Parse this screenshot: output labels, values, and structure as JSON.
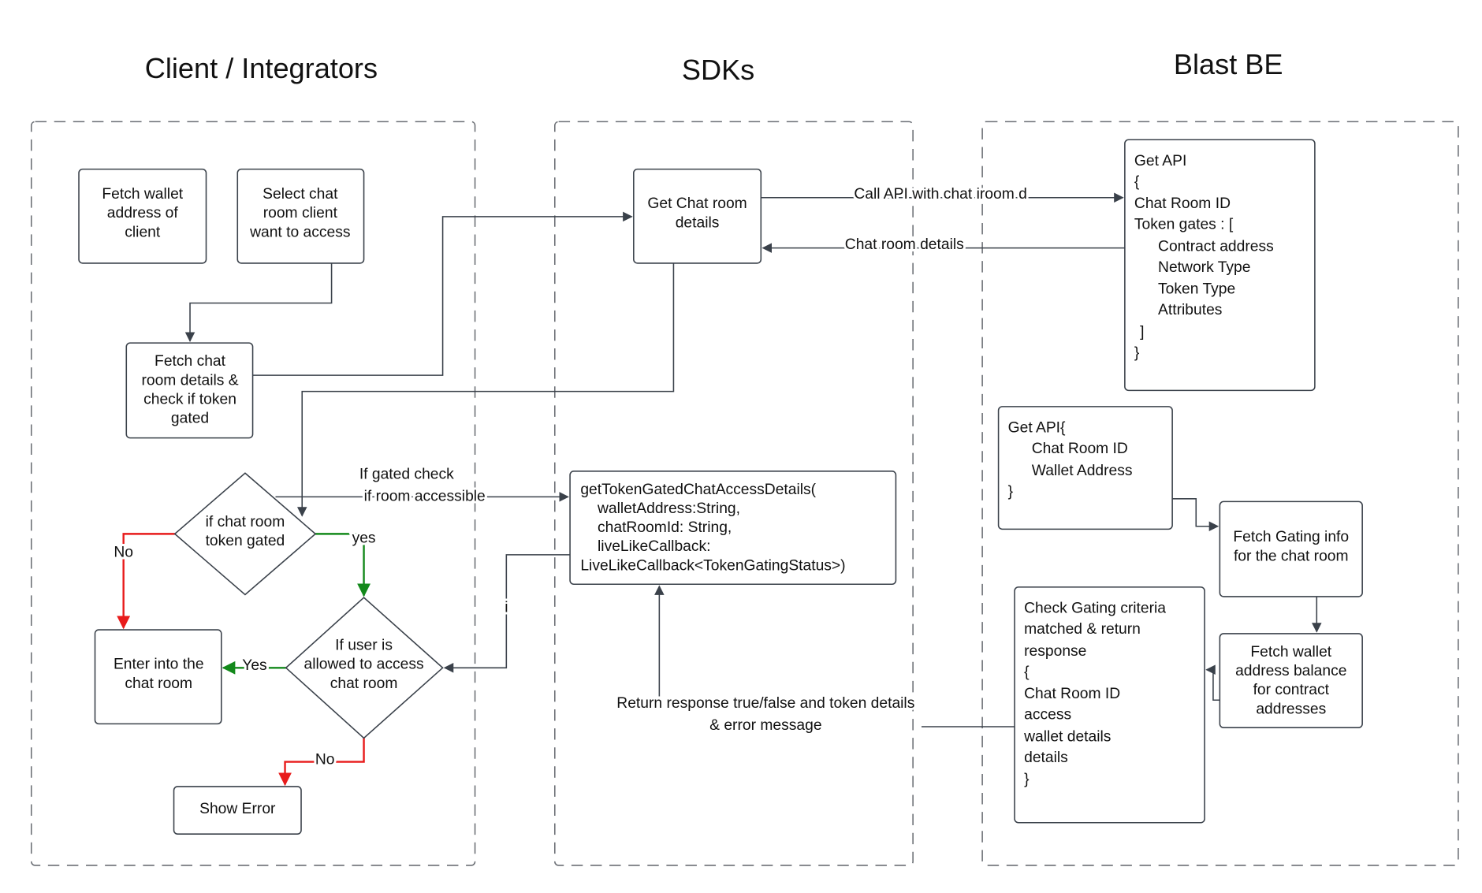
{
  "lanes": {
    "client": "Client / Integrators",
    "sdks": "SDKs",
    "backend": "Blast BE"
  },
  "colors": {
    "line": "#3a414a",
    "yes": "#13891b",
    "no": "#e81b1b"
  },
  "nodes": {
    "fetch_wallet": [
      "Fetch wallet",
      "address of",
      "client"
    ],
    "select_chat": [
      "Select chat",
      "room  client",
      "want to access"
    ],
    "fetch_chat_details": [
      "Fetch chat",
      "room details &",
      "check if token",
      "gated"
    ],
    "get_chat_room": [
      "Get Chat room",
      "details"
    ],
    "is_token_gated": [
      "if chat room",
      "token gated"
    ],
    "is_user_allowed": [
      "If user is",
      "allowed to access",
      "chat room"
    ],
    "enter_chat_room": [
      "Enter into the",
      "chat room"
    ],
    "show_error": "Show Error",
    "sdk_method": [
      "getTokenGatedChatAccessDetails(",
      "walletAddress:String,",
      "chatRoomId: String,",
      "liveLikeCallback:",
      "LiveLikeCallback<TokenGatingStatus>)"
    ],
    "get_api_chat_room": [
      "Get API",
      "{",
      "Chat Room ID",
      "Token gates : [",
      "Contract address",
      "Network Type",
      "Token Type",
      "Attributes",
      "]",
      "}"
    ],
    "get_api_access": [
      "Get API{",
      "Chat Room ID",
      "Wallet Address",
      "}"
    ],
    "fetch_gating_info": [
      "Fetch Gating info",
      "for the chat room"
    ],
    "fetch_wallet_balance": [
      "Fetch wallet",
      "address balance",
      "for contract",
      "addresses"
    ],
    "check_gating": [
      "Check Gating criteria",
      "matched & return",
      "response",
      "{",
      "Chat Room ID",
      "access",
      "wallet details",
      "details",
      "}"
    ]
  },
  "edges": {
    "call_api": "Call API with chat iroom d",
    "chat_room_details": "Chat room details",
    "gated_check": [
      "If gated check",
      "if room accessible"
    ],
    "yes_lower": "yes",
    "no_1": "No",
    "yes_upper": "Yes",
    "no_2": "No",
    "callback": "i",
    "return_response": [
      "Return response true/false and token details",
      "& error message"
    ]
  }
}
